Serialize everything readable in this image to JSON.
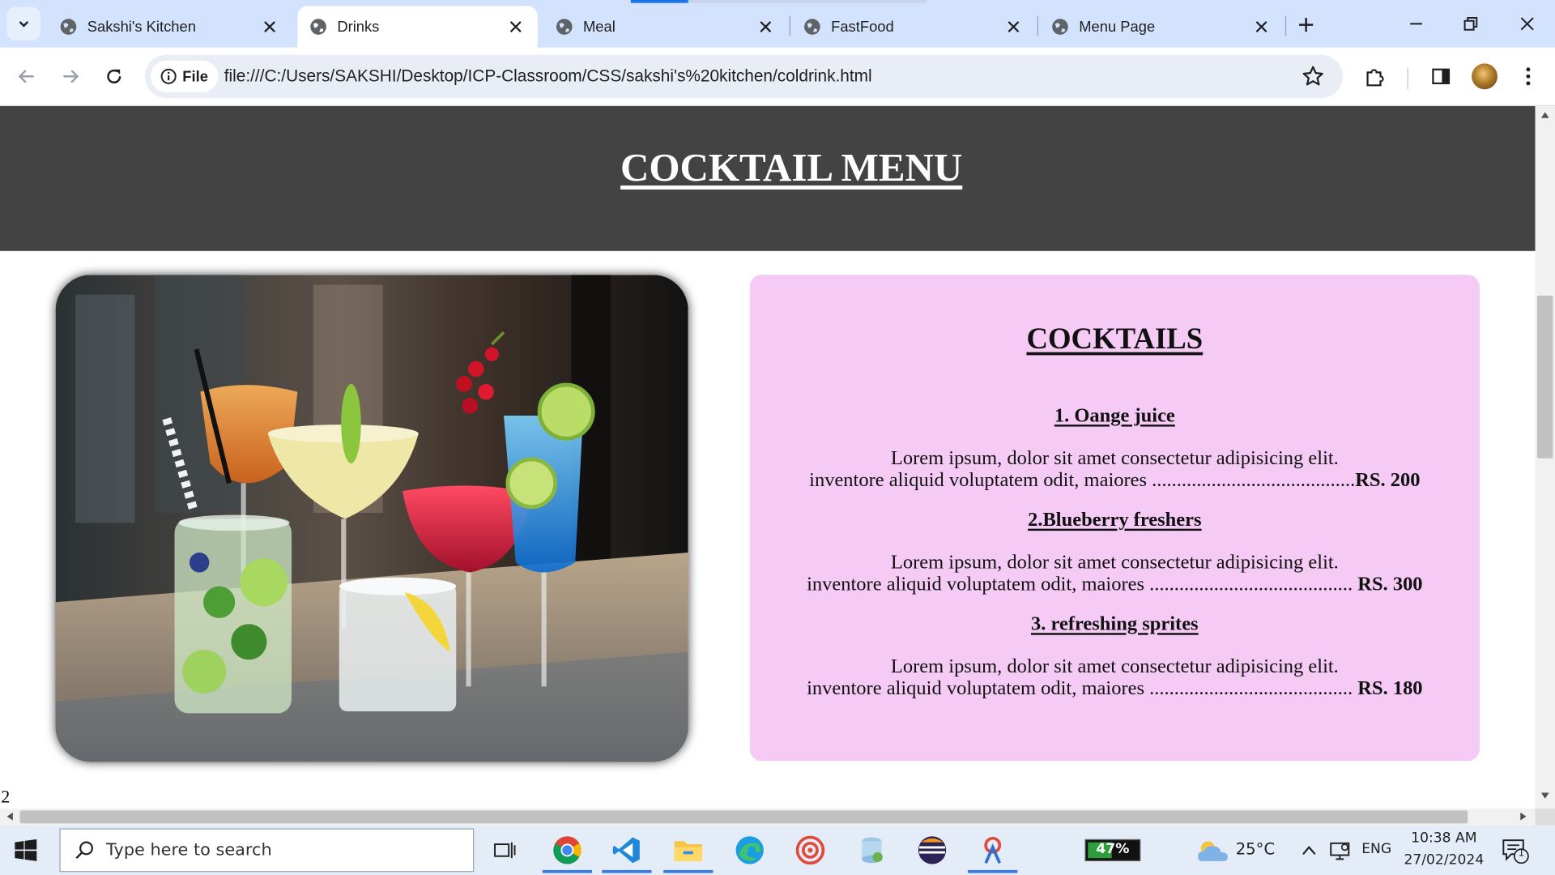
{
  "browser": {
    "tabs": [
      {
        "label": "Sakshi's Kitchen",
        "active": false
      },
      {
        "label": "Drinks",
        "active": true
      },
      {
        "label": "Meal",
        "active": false
      },
      {
        "label": "FastFood",
        "active": false
      },
      {
        "label": "Menu Page",
        "active": false
      }
    ],
    "site_chip": "File",
    "url": "file:///C:/Users/SAKSHI/Desktop/ICP-Classroom/CSS/sakshi's%20kitchen/coldrink.html"
  },
  "page": {
    "title": "COCKTAIL MENU",
    "card_title": "COCKTAILS",
    "items": [
      {
        "name": "1. Oange juice",
        "line1": "Lorem ipsum, dolor sit amet consectetur adipisicing elit.",
        "line2": "inventore aliquid voluptatem odit, maiores .........................................",
        "price": "RS. 200"
      },
      {
        "name": "2.Blueberry freshers",
        "line1": "Lorem ipsum, dolor sit amet consectetur adipisicing elit.",
        "line2": "inventore aliquid voluptatem odit, maiores ......................................... ",
        "price": "RS. 300"
      },
      {
        "name": "3. refreshing sprites",
        "line1": "Lorem ipsum, dolor sit amet consectetur adipisicing elit.",
        "line2": "inventore aliquid voluptatem odit, maiores ......................................... ",
        "price": "RS. 180"
      }
    ],
    "page_number": "2",
    "colors": {
      "header_bg": "#434343",
      "card_bg": "#f5cbf5"
    }
  },
  "taskbar": {
    "search_placeholder": "Type here to search",
    "battery": "47%",
    "battery_level": 0.47,
    "temperature": "25°C",
    "language": "ENG",
    "time": "10:38 AM",
    "date": "27/02/2024",
    "notification_count": "1"
  }
}
